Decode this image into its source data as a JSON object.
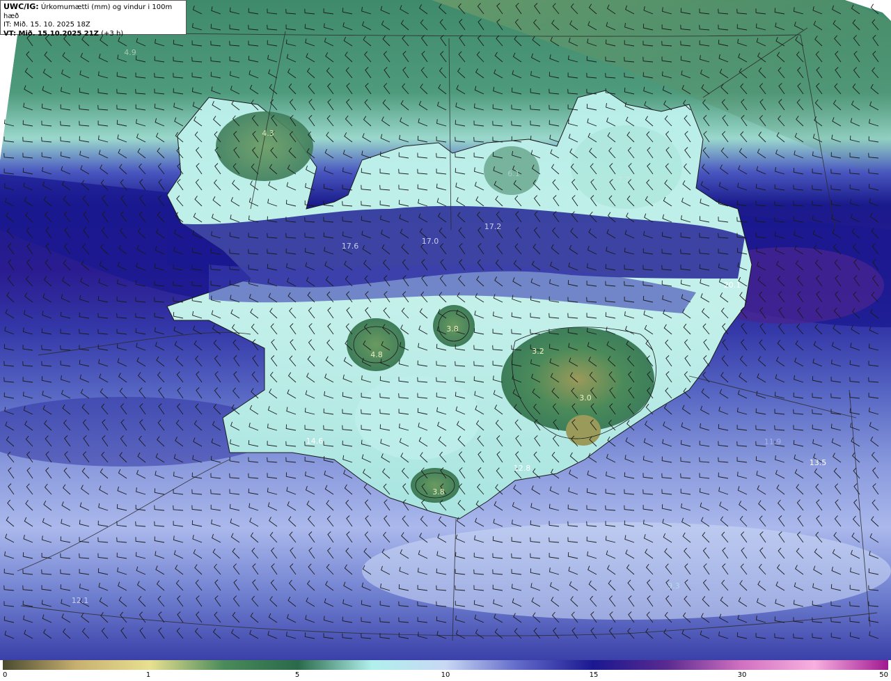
{
  "header": {
    "model_prefix": "UWC/IG:",
    "title": "Úrkomumætti (mm) og vindur i 100m hæð",
    "initial_time": "IT: Mið. 15. 10. 2025 18Z",
    "valid_prefix": "VT: Mið. 15.10.2025 21Z",
    "valid_offset": "(+3 h)"
  },
  "colorbar": {
    "ticks": [
      {
        "label": "0",
        "value": 0
      },
      {
        "label": "1",
        "value": 1
      },
      {
        "label": "5",
        "value": 5
      },
      {
        "label": "10",
        "value": 10
      },
      {
        "label": "15",
        "value": 15
      },
      {
        "label": "30",
        "value": 30
      },
      {
        "label": "50",
        "value": 50
      }
    ],
    "colors": [
      "#4a4a30",
      "#c8b070",
      "#e8e090",
      "#4a8a5a",
      "#2a6a4a",
      "#b0f0ec",
      "#c8d8f4",
      "#6068c8",
      "#1a1890",
      "#5a2a90",
      "#d070c0",
      "#f8b0e0",
      "#a01890"
    ]
  },
  "value_labels": [
    {
      "text": "4.9",
      "color": "#a8c8b0"
    },
    {
      "text": "4.3",
      "color": "#d8e8b0"
    },
    {
      "text": "6.1",
      "color": "#a8d0c8"
    },
    {
      "text": "7.7",
      "color": "#c8e8e0"
    },
    {
      "text": "17.6",
      "color": "#c8d0f0"
    },
    {
      "text": "17.0",
      "color": "#c8d0f0"
    },
    {
      "text": "17.2",
      "color": "#c8d0f0"
    },
    {
      "text": "20.1",
      "color": "#ffffff"
    },
    {
      "text": "3.8",
      "color": "#e8f0c0"
    },
    {
      "text": "4.8",
      "color": "#e8f0c0"
    },
    {
      "text": "3.2",
      "color": "#f0f0c0"
    },
    {
      "text": "3.0",
      "color": "#f0f0c0"
    },
    {
      "text": "14.6",
      "color": "#ffffff"
    },
    {
      "text": "12.8",
      "color": "#ffffff"
    },
    {
      "text": "3.8",
      "color": "#e8f0c0"
    },
    {
      "text": "11.9",
      "color": "#a8b0e8"
    },
    {
      "text": "13.5",
      "color": "#ffffff"
    },
    {
      "text": "9.3",
      "color": "#b8d8f0"
    },
    {
      "text": "12.1",
      "color": "#c8d0f0"
    }
  ]
}
